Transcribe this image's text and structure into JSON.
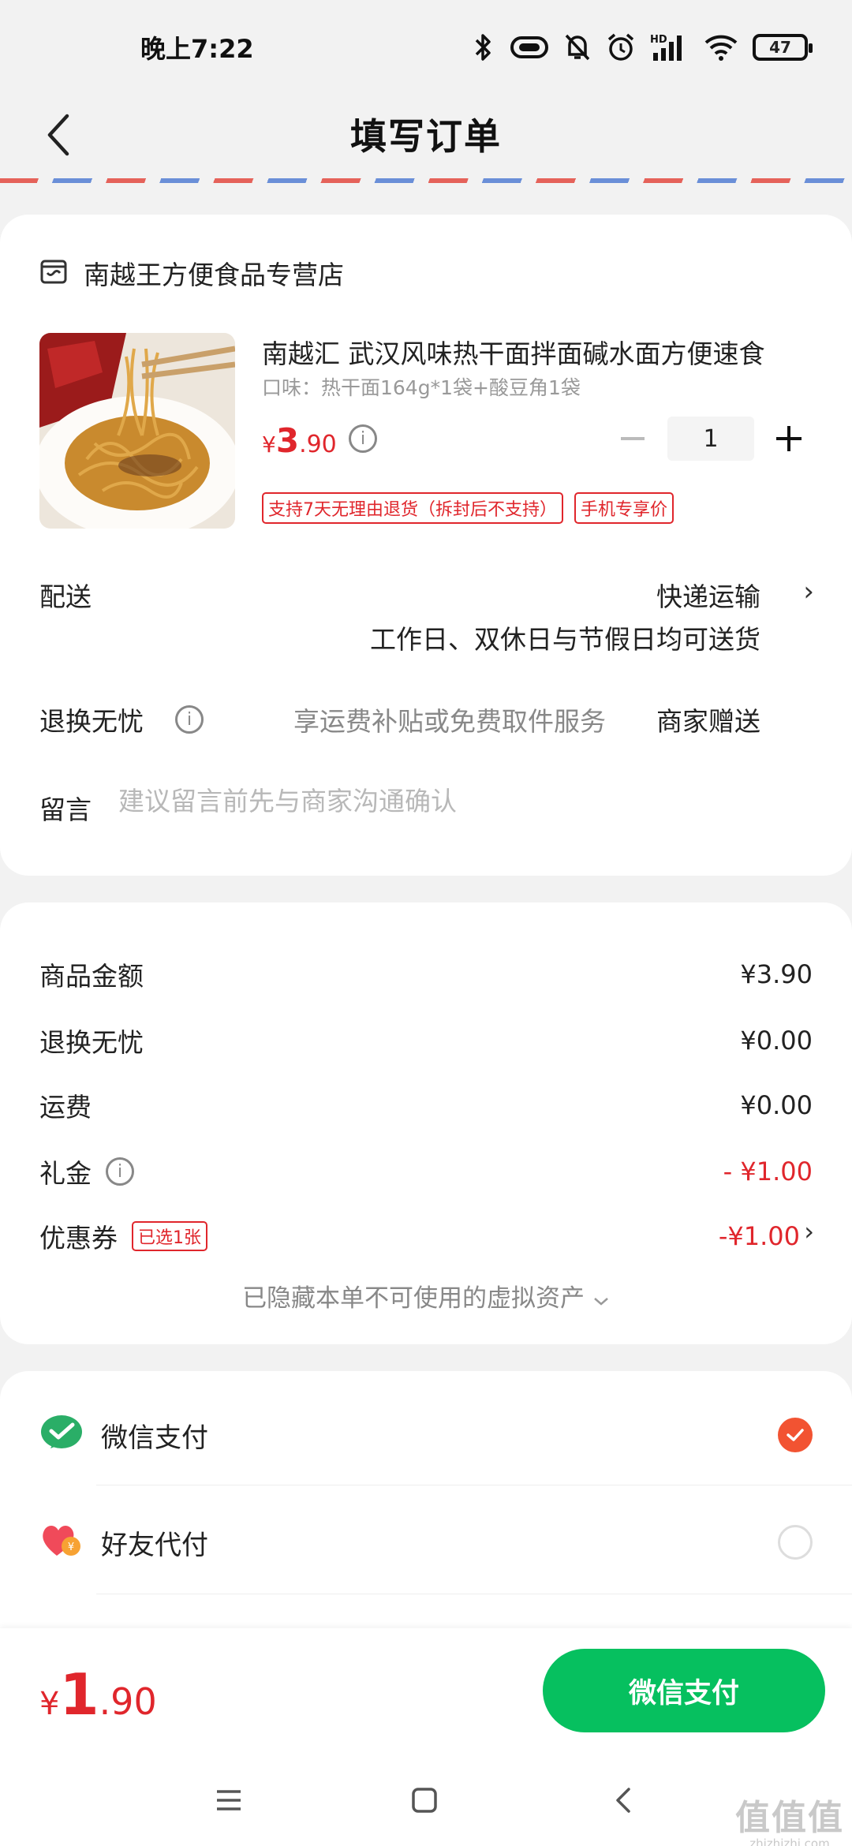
{
  "status_bar": {
    "time": "晚上7:22",
    "battery": "47",
    "network": "HD"
  },
  "header": {
    "title": "填写订单"
  },
  "store": {
    "name": "南越王方便食品专营店"
  },
  "product": {
    "title": "南越汇 武汉风味热干面拌面碱水面方便速食",
    "spec": "口味：热干面164g*1袋+酸豆角1袋",
    "price_symbol": "¥",
    "price_int": "3",
    "price_dec": ".90",
    "quantity": "1",
    "tags": [
      "支持7天无理由退货（拆封后不支持）",
      "手机专享价"
    ]
  },
  "delivery": {
    "label": "配送",
    "method": "快递运输",
    "note": "工作日、双休日与节假日均可送货"
  },
  "refund": {
    "label": "退换无忧",
    "desc": "享运费补贴或免费取件服务",
    "gift": "商家赠送"
  },
  "remark": {
    "label": "留言",
    "placeholder": "建议留言前先与商家沟通确认"
  },
  "summary": {
    "items": [
      {
        "label": "商品金额",
        "value": "¥3.90"
      },
      {
        "label": "退换无忧",
        "value": "¥0.00"
      },
      {
        "label": "运费",
        "value": "¥0.00"
      },
      {
        "label": "礼金",
        "value": "- ¥1.00"
      },
      {
        "label": "优惠券",
        "value": "-¥1.00",
        "tag": "已选1张"
      }
    ],
    "hidden_assets": "已隐藏本单不可使用的虚拟资产"
  },
  "payment": {
    "options": [
      {
        "label": "微信支付",
        "selected": true
      },
      {
        "label": "好友代付",
        "selected": false
      }
    ]
  },
  "bottom": {
    "total_symbol": "¥",
    "total_int": "1",
    "total_dec": ".90",
    "pay_button": "微信支付"
  },
  "watermark": {
    "logo": "值值值",
    "url": "zhizhizhi.com"
  },
  "colors": {
    "accent_red": "#e0262c",
    "wechat_green": "#06c05f",
    "radio_selected": "#f25332"
  },
  "icons": [
    "bluetooth-icon",
    "battery-saver-icon",
    "mute-icon",
    "alarm-icon",
    "signal-icon",
    "wifi-icon",
    "battery-icon",
    "back-icon",
    "store-icon",
    "info-icon",
    "minus-icon",
    "plus-icon",
    "chevron-right-icon",
    "chevron-down-icon",
    "wechat-pay-icon",
    "friend-pay-icon",
    "check-icon",
    "menu-icon",
    "home-icon"
  ]
}
